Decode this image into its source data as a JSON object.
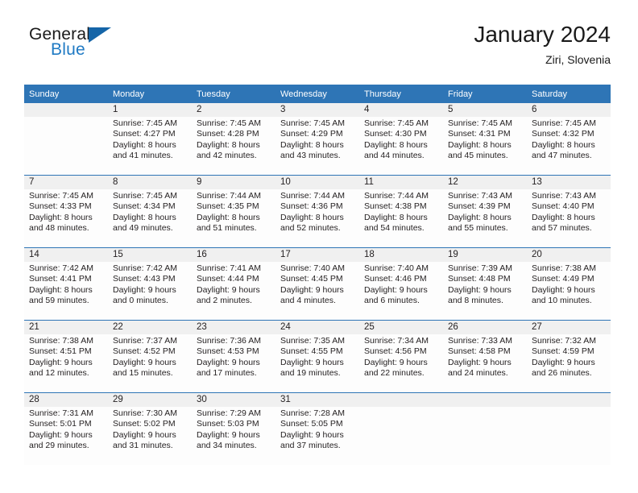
{
  "brand": {
    "name_top": "General",
    "name_bottom": "Blue",
    "triangle_icon": "triangle-icon",
    "accent_color": "#1565a8",
    "blue_text_color": "#1f7ac4"
  },
  "header": {
    "title": "January 2024",
    "location": "Ziri, Slovenia"
  },
  "theme": {
    "header_bg": "#2e75b6",
    "header_text": "#ffffff",
    "daynum_bg": "#f0f0f0",
    "cell_bg": "#fdfdfd",
    "rule_color": "#2e75b6",
    "text_color": "#231f20"
  },
  "weekday_headers": [
    "Sunday",
    "Monday",
    "Tuesday",
    "Wednesday",
    "Thursday",
    "Friday",
    "Saturday"
  ],
  "labels": {
    "sunrise_prefix": "Sunrise:",
    "sunset_prefix": "Sunset:",
    "daylight_prefix": "Daylight:"
  },
  "weeks": [
    [
      {
        "day": "",
        "lines": []
      },
      {
        "day": "1",
        "lines": [
          "Sunrise: 7:45 AM",
          "Sunset: 4:27 PM",
          "Daylight: 8 hours",
          "and 41 minutes."
        ]
      },
      {
        "day": "2",
        "lines": [
          "Sunrise: 7:45 AM",
          "Sunset: 4:28 PM",
          "Daylight: 8 hours",
          "and 42 minutes."
        ]
      },
      {
        "day": "3",
        "lines": [
          "Sunrise: 7:45 AM",
          "Sunset: 4:29 PM",
          "Daylight: 8 hours",
          "and 43 minutes."
        ]
      },
      {
        "day": "4",
        "lines": [
          "Sunrise: 7:45 AM",
          "Sunset: 4:30 PM",
          "Daylight: 8 hours",
          "and 44 minutes."
        ]
      },
      {
        "day": "5",
        "lines": [
          "Sunrise: 7:45 AM",
          "Sunset: 4:31 PM",
          "Daylight: 8 hours",
          "and 45 minutes."
        ]
      },
      {
        "day": "6",
        "lines": [
          "Sunrise: 7:45 AM",
          "Sunset: 4:32 PM",
          "Daylight: 8 hours",
          "and 47 minutes."
        ]
      }
    ],
    [
      {
        "day": "7",
        "lines": [
          "Sunrise: 7:45 AM",
          "Sunset: 4:33 PM",
          "Daylight: 8 hours",
          "and 48 minutes."
        ]
      },
      {
        "day": "8",
        "lines": [
          "Sunrise: 7:45 AM",
          "Sunset: 4:34 PM",
          "Daylight: 8 hours",
          "and 49 minutes."
        ]
      },
      {
        "day": "9",
        "lines": [
          "Sunrise: 7:44 AM",
          "Sunset: 4:35 PM",
          "Daylight: 8 hours",
          "and 51 minutes."
        ]
      },
      {
        "day": "10",
        "lines": [
          "Sunrise: 7:44 AM",
          "Sunset: 4:36 PM",
          "Daylight: 8 hours",
          "and 52 minutes."
        ]
      },
      {
        "day": "11",
        "lines": [
          "Sunrise: 7:44 AM",
          "Sunset: 4:38 PM",
          "Daylight: 8 hours",
          "and 54 minutes."
        ]
      },
      {
        "day": "12",
        "lines": [
          "Sunrise: 7:43 AM",
          "Sunset: 4:39 PM",
          "Daylight: 8 hours",
          "and 55 minutes."
        ]
      },
      {
        "day": "13",
        "lines": [
          "Sunrise: 7:43 AM",
          "Sunset: 4:40 PM",
          "Daylight: 8 hours",
          "and 57 minutes."
        ]
      }
    ],
    [
      {
        "day": "14",
        "lines": [
          "Sunrise: 7:42 AM",
          "Sunset: 4:41 PM",
          "Daylight: 8 hours",
          "and 59 minutes."
        ]
      },
      {
        "day": "15",
        "lines": [
          "Sunrise: 7:42 AM",
          "Sunset: 4:43 PM",
          "Daylight: 9 hours",
          "and 0 minutes."
        ]
      },
      {
        "day": "16",
        "lines": [
          "Sunrise: 7:41 AM",
          "Sunset: 4:44 PM",
          "Daylight: 9 hours",
          "and 2 minutes."
        ]
      },
      {
        "day": "17",
        "lines": [
          "Sunrise: 7:40 AM",
          "Sunset: 4:45 PM",
          "Daylight: 9 hours",
          "and 4 minutes."
        ]
      },
      {
        "day": "18",
        "lines": [
          "Sunrise: 7:40 AM",
          "Sunset: 4:46 PM",
          "Daylight: 9 hours",
          "and 6 minutes."
        ]
      },
      {
        "day": "19",
        "lines": [
          "Sunrise: 7:39 AM",
          "Sunset: 4:48 PM",
          "Daylight: 9 hours",
          "and 8 minutes."
        ]
      },
      {
        "day": "20",
        "lines": [
          "Sunrise: 7:38 AM",
          "Sunset: 4:49 PM",
          "Daylight: 9 hours",
          "and 10 minutes."
        ]
      }
    ],
    [
      {
        "day": "21",
        "lines": [
          "Sunrise: 7:38 AM",
          "Sunset: 4:51 PM",
          "Daylight: 9 hours",
          "and 12 minutes."
        ]
      },
      {
        "day": "22",
        "lines": [
          "Sunrise: 7:37 AM",
          "Sunset: 4:52 PM",
          "Daylight: 9 hours",
          "and 15 minutes."
        ]
      },
      {
        "day": "23",
        "lines": [
          "Sunrise: 7:36 AM",
          "Sunset: 4:53 PM",
          "Daylight: 9 hours",
          "and 17 minutes."
        ]
      },
      {
        "day": "24",
        "lines": [
          "Sunrise: 7:35 AM",
          "Sunset: 4:55 PM",
          "Daylight: 9 hours",
          "and 19 minutes."
        ]
      },
      {
        "day": "25",
        "lines": [
          "Sunrise: 7:34 AM",
          "Sunset: 4:56 PM",
          "Daylight: 9 hours",
          "and 22 minutes."
        ]
      },
      {
        "day": "26",
        "lines": [
          "Sunrise: 7:33 AM",
          "Sunset: 4:58 PM",
          "Daylight: 9 hours",
          "and 24 minutes."
        ]
      },
      {
        "day": "27",
        "lines": [
          "Sunrise: 7:32 AM",
          "Sunset: 4:59 PM",
          "Daylight: 9 hours",
          "and 26 minutes."
        ]
      }
    ],
    [
      {
        "day": "28",
        "lines": [
          "Sunrise: 7:31 AM",
          "Sunset: 5:01 PM",
          "Daylight: 9 hours",
          "and 29 minutes."
        ]
      },
      {
        "day": "29",
        "lines": [
          "Sunrise: 7:30 AM",
          "Sunset: 5:02 PM",
          "Daylight: 9 hours",
          "and 31 minutes."
        ]
      },
      {
        "day": "30",
        "lines": [
          "Sunrise: 7:29 AM",
          "Sunset: 5:03 PM",
          "Daylight: 9 hours",
          "and 34 minutes."
        ]
      },
      {
        "day": "31",
        "lines": [
          "Sunrise: 7:28 AM",
          "Sunset: 5:05 PM",
          "Daylight: 9 hours",
          "and 37 minutes."
        ]
      },
      {
        "day": "",
        "lines": []
      },
      {
        "day": "",
        "lines": []
      },
      {
        "day": "",
        "lines": []
      }
    ]
  ]
}
